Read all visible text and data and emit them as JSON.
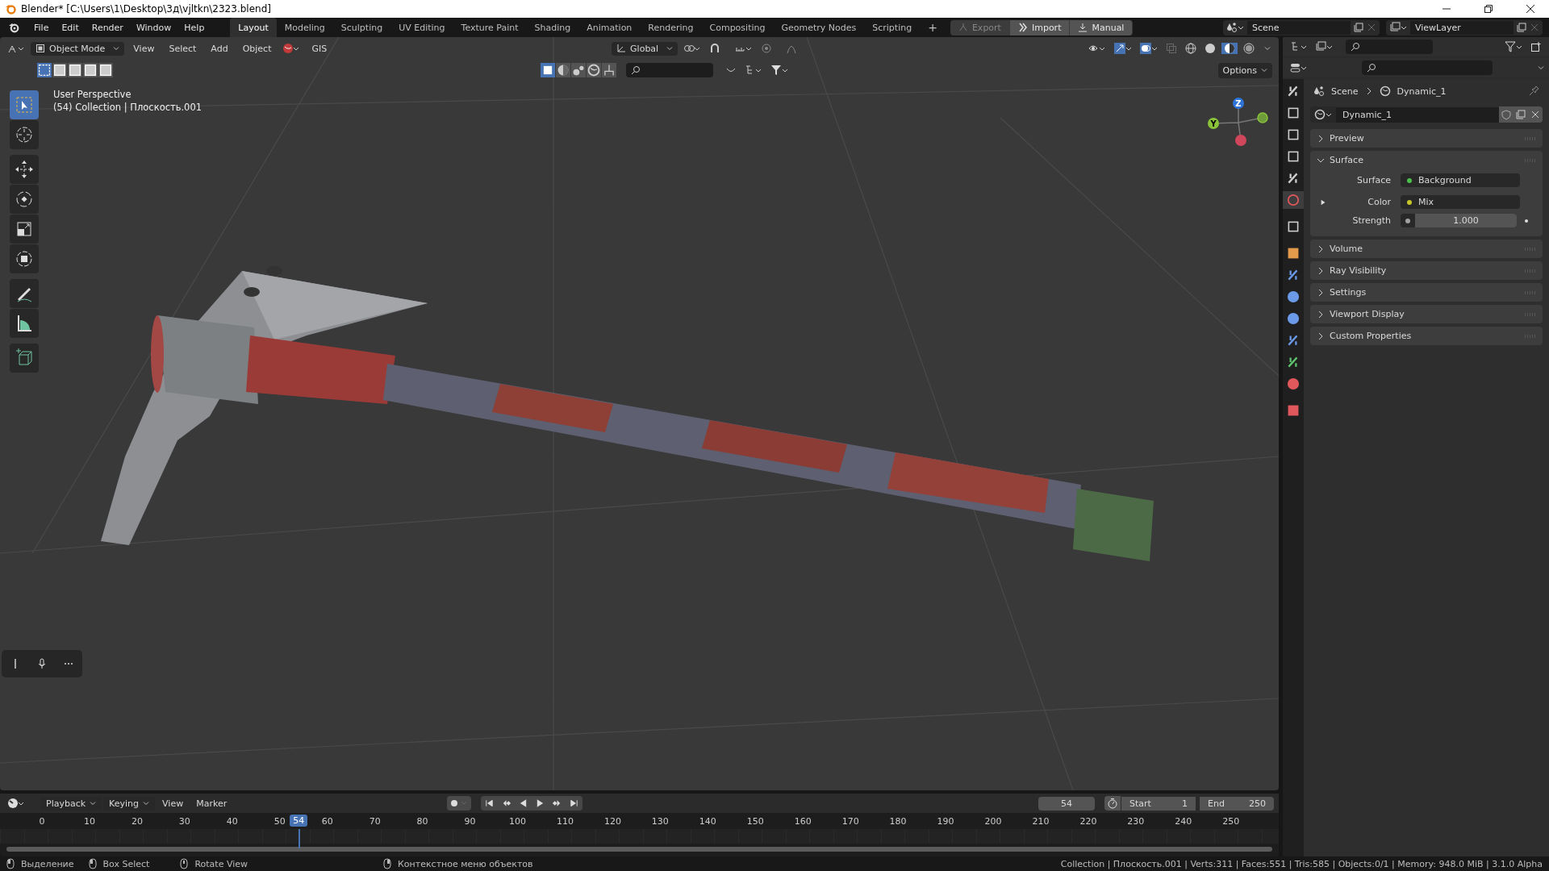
{
  "window": {
    "title": "Blender* [C:\\Users\\1\\Desktop\\3д\\vjltkn\\2323.blend]"
  },
  "menu": [
    "File",
    "Edit",
    "Render",
    "Window",
    "Help"
  ],
  "workspaces": [
    {
      "label": "Layout",
      "selected": true
    },
    {
      "label": "Modeling",
      "selected": false
    },
    {
      "label": "Sculpting",
      "selected": false
    },
    {
      "label": "UV Editing",
      "selected": false
    },
    {
      "label": "Texture Paint",
      "selected": false
    },
    {
      "label": "Shading",
      "selected": false
    },
    {
      "label": "Animation",
      "selected": false
    },
    {
      "label": "Rendering",
      "selected": false
    },
    {
      "label": "Compositing",
      "selected": false
    },
    {
      "label": "Geometry Nodes",
      "selected": false
    },
    {
      "label": "Scripting",
      "selected": false
    }
  ],
  "add_workspace": "+",
  "addon_buttons": [
    {
      "kind": "export",
      "label": "Export",
      "disabled": true
    },
    {
      "kind": "import",
      "label": "Import",
      "disabled": false
    },
    {
      "kind": "manual",
      "label": "Manual",
      "disabled": false
    }
  ],
  "scene": "Scene",
  "view_layer": "ViewLayer",
  "viewport": {
    "mode": "Object Mode",
    "menus": [
      "View",
      "Select",
      "Add",
      "Object"
    ],
    "gis": "GIS",
    "orientation": "Global",
    "options": "Options",
    "view_name": "User Perspective",
    "collection": "(54) Collection | Плоскость.001",
    "gizmo": [
      {
        "label": "Z",
        "color": "#2e74d8"
      },
      {
        "label": "Y",
        "color": "#8ac33a"
      }
    ],
    "tools": [
      {
        "kind": "select",
        "selected": true
      },
      {
        "kind": "cursor",
        "selected": false
      },
      {
        "kind": "move",
        "selected": false
      },
      {
        "kind": "rotate",
        "selected": false
      },
      {
        "kind": "scale",
        "selected": false
      },
      {
        "kind": "transform",
        "selected": false
      },
      {
        "kind": "annotate",
        "selected": false
      },
      {
        "kind": "measure",
        "selected": false
      },
      {
        "kind": "add-cube",
        "selected": false
      }
    ]
  },
  "properties": {
    "breadcrumb": [
      "Scene",
      "Dynamic_1"
    ],
    "world_name": "Dynamic_1",
    "tabs": [
      {
        "kind": "tool",
        "selected": false
      },
      {
        "kind": "render",
        "selected": false
      },
      {
        "kind": "output",
        "selected": false
      },
      {
        "kind": "view-layer",
        "selected": false
      },
      {
        "kind": "scene",
        "selected": false
      },
      {
        "kind": "world",
        "selected": true
      },
      {
        "kind": "collection",
        "selected": false
      },
      {
        "kind": "object",
        "selected": false
      },
      {
        "kind": "modifier",
        "selected": false
      },
      {
        "kind": "particles",
        "selected": false
      },
      {
        "kind": "physics",
        "selected": false
      },
      {
        "kind": "constraints",
        "selected": false
      },
      {
        "kind": "data",
        "selected": false
      },
      {
        "kind": "material",
        "selected": false
      },
      {
        "kind": "texture",
        "selected": false
      }
    ],
    "panels": [
      {
        "title": "Preview",
        "expanded": false
      },
      {
        "title": "Surface",
        "expanded": true,
        "fields": [
          {
            "kind": "socket",
            "label": "Surface",
            "value": "Background",
            "color": "#4cbf4c"
          },
          {
            "kind": "socket",
            "label": "Color",
            "value": "Mix",
            "color": "#c7c729",
            "expandable": true
          },
          {
            "kind": "number",
            "label": "Strength",
            "value": "1.000",
            "color": "#a1a1a1"
          }
        ]
      },
      {
        "title": "Volume",
        "expanded": false
      },
      {
        "title": "Ray Visibility",
        "expanded": false
      },
      {
        "title": "Settings",
        "expanded": false
      },
      {
        "title": "Viewport Display",
        "expanded": false
      },
      {
        "title": "Custom Properties",
        "expanded": false
      }
    ]
  },
  "timeline": {
    "menus": [
      "Playback",
      "Keying",
      "View",
      "Marker"
    ],
    "current_frame": "54",
    "start_label": "Start",
    "start": "1",
    "end_label": "End",
    "end": "250",
    "ticks": [
      "0",
      "10",
      "20",
      "30",
      "40",
      "50",
      "60",
      "70",
      "80",
      "90",
      "100",
      "110",
      "120",
      "130",
      "140",
      "150",
      "160",
      "170",
      "180",
      "190",
      "200",
      "210",
      "220",
      "230",
      "240",
      "250"
    ],
    "playhead": {
      "label": "54",
      "level": 0.216
    }
  },
  "status_bar": {
    "hints": [
      {
        "kind": "left",
        "text": "Выделение"
      },
      {
        "kind": "drag",
        "text": "Box Select"
      },
      {
        "kind": "middle",
        "text": "Rotate View"
      },
      {
        "kind": "right",
        "text": "Контекстное меню объектов"
      }
    ],
    "info": "Collection | Плоскость.001 | Verts:311 | Faces:551 | Tris:585 | Objects:0/1 | Memory: 948.0 MiB | 3.1.0 Alpha"
  }
}
